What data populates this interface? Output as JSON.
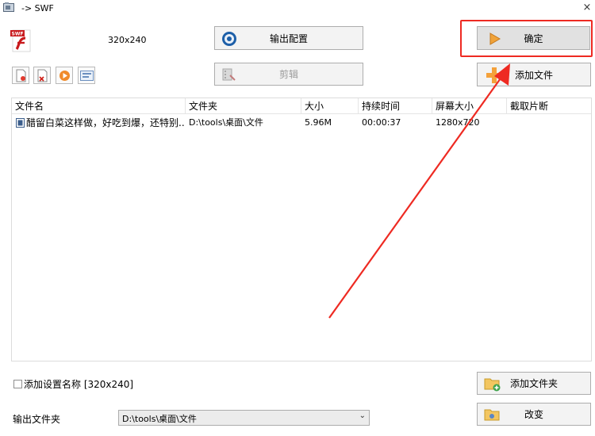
{
  "window": {
    "title": "-> SWF",
    "close_glyph": "×"
  },
  "profile": {
    "resolution_label": "320x240",
    "format_icon": "swf-icon"
  },
  "buttons": {
    "output_config": "输出配置",
    "confirm": "确定",
    "clip": "剪辑",
    "add_file": "添加文件",
    "add_folder": "添加文件夹",
    "change": "改变"
  },
  "toolbar_icons": [
    "remove-file-icon",
    "clear-list-icon",
    "play-icon",
    "media-info-icon"
  ],
  "file_list": {
    "columns": [
      "文件名",
      "文件夹",
      "大小",
      "持续时间",
      "屏幕大小",
      "截取片断"
    ],
    "rows": [
      {
        "name": "醋留白菜这样做，好吃到爆，还特别...",
        "folder": "D:\\tools\\桌面\\文件",
        "size": "5.96M",
        "duration": "00:00:37",
        "screen_size": "1280x720",
        "clip": ""
      }
    ]
  },
  "settings": {
    "add_setting_name_label": "添加设置名称 [320x240]",
    "add_setting_name_checked": false,
    "output_folder_label": "输出文件夹",
    "output_folder_value": "D:\\tools\\桌面\\文件"
  },
  "annotation": {
    "highlight_color": "#ee2a22"
  }
}
